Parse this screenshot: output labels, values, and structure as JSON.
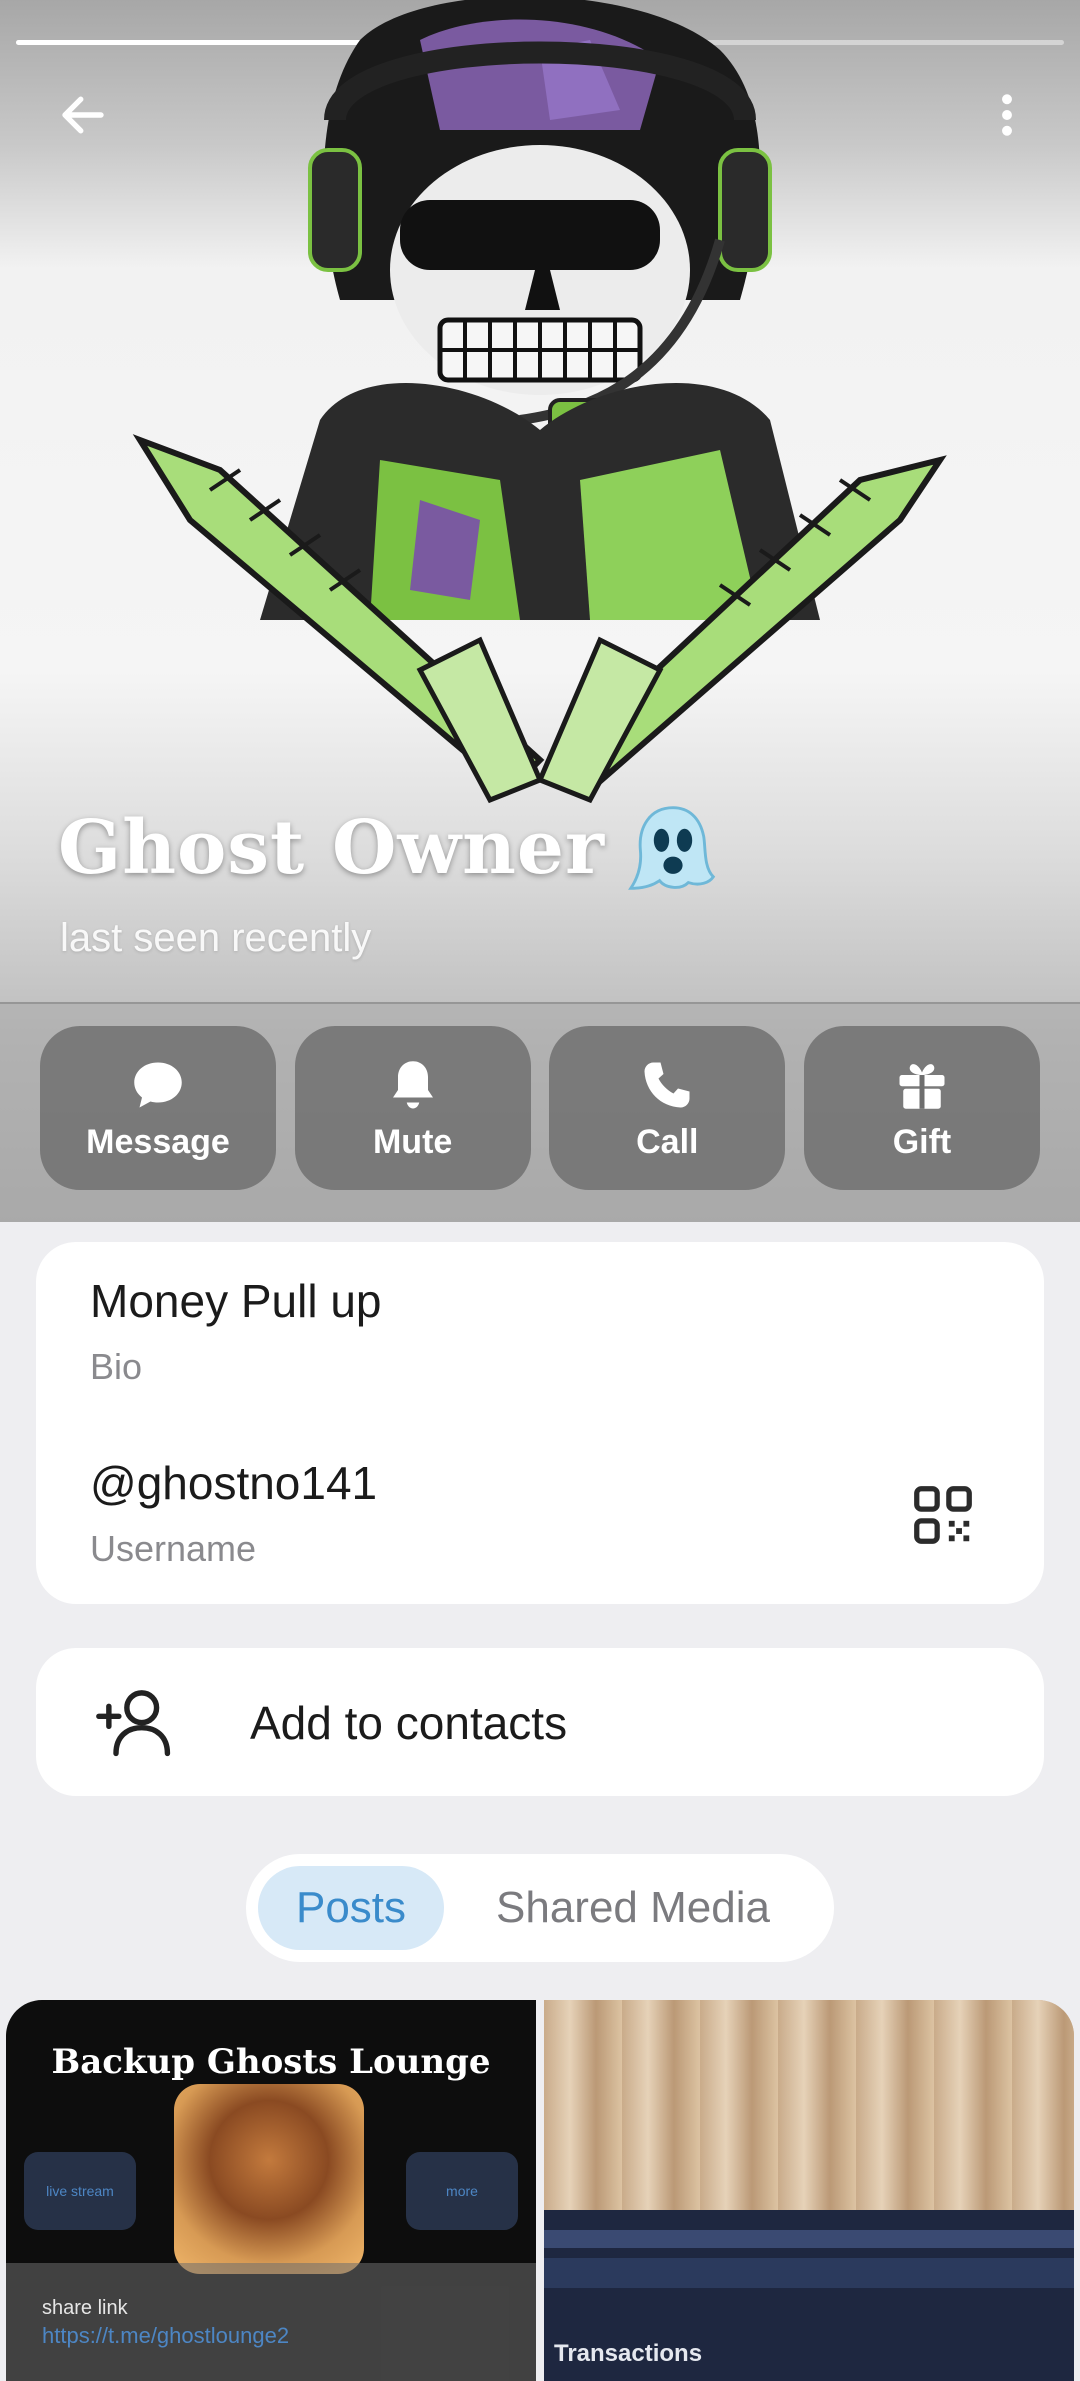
{
  "header": {
    "story_progress_fraction": 0.5,
    "back_icon": "arrow-left-icon",
    "more_icon": "vertical-dots-icon",
    "name": "Ghost Owner",
    "name_emoji": "ghost-emoji-icon",
    "status": "last seen recently"
  },
  "actions": [
    {
      "label": "Message",
      "icon": "chat-bubble-icon"
    },
    {
      "label": "Mute",
      "icon": "bell-icon"
    },
    {
      "label": "Call",
      "icon": "phone-icon"
    },
    {
      "label": "Gift",
      "icon": "gift-icon"
    }
  ],
  "info": {
    "bio_value": "Money Pull up",
    "bio_label": "Bio",
    "username_value": "@ghostno141",
    "username_label": "Username",
    "qr_icon": "qr-code-icon"
  },
  "contacts": {
    "label": "Add to contacts",
    "icon": "add-person-icon"
  },
  "tabs": [
    {
      "label": "Posts",
      "active": true
    },
    {
      "label": "Shared Media",
      "active": false
    }
  ],
  "posts": {
    "left": {
      "title": "Backup Ghosts Lounge",
      "btn_live": "live stream",
      "btn_more": "more",
      "share_label": "share link",
      "share_url": "https://t.me/ghostlounge2"
    },
    "right": {
      "title": "Transactions"
    }
  },
  "colors": {
    "accent": "#3a8bcb",
    "tab_active_bg": "#d7e9f7",
    "page_bg": "#eeeef1"
  }
}
